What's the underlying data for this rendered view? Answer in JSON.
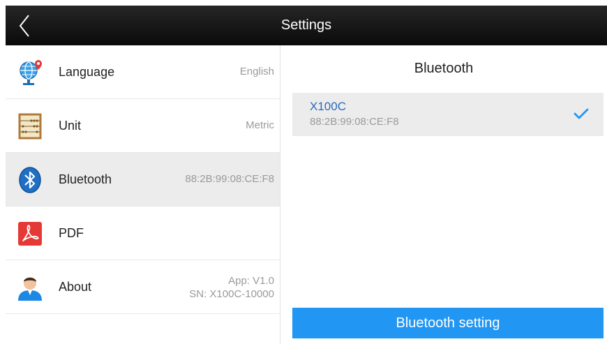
{
  "header": {
    "title": "Settings",
    "back_icon": "chevron-left-icon"
  },
  "settings_list": [
    {
      "label": "Language",
      "value": "English",
      "icon": "globe-location-icon",
      "selected": false
    },
    {
      "label": "Unit",
      "value": "Metric",
      "icon": "abacus-icon",
      "selected": false
    },
    {
      "label": "Bluetooth",
      "value": "88:2B:99:08:CE:F8",
      "icon": "bluetooth-icon",
      "selected": true
    },
    {
      "label": "PDF",
      "value": "",
      "icon": "pdf-icon",
      "selected": false
    },
    {
      "label": "About",
      "value_line1": "App: V1.0",
      "value_line2": "SN: X100C-10000",
      "icon": "user-icon",
      "selected": false
    }
  ],
  "bluetooth_panel": {
    "title": "Bluetooth",
    "device": {
      "name": "X100C",
      "mac": "88:2B:99:08:CE:F8",
      "connected_icon": "checkmark-icon"
    },
    "setting_button": "Bluetooth setting"
  },
  "colors": {
    "accent": "#2196f3",
    "device_name": "#2a6ab8",
    "header": "#141414",
    "selected_row": "#ececec"
  }
}
